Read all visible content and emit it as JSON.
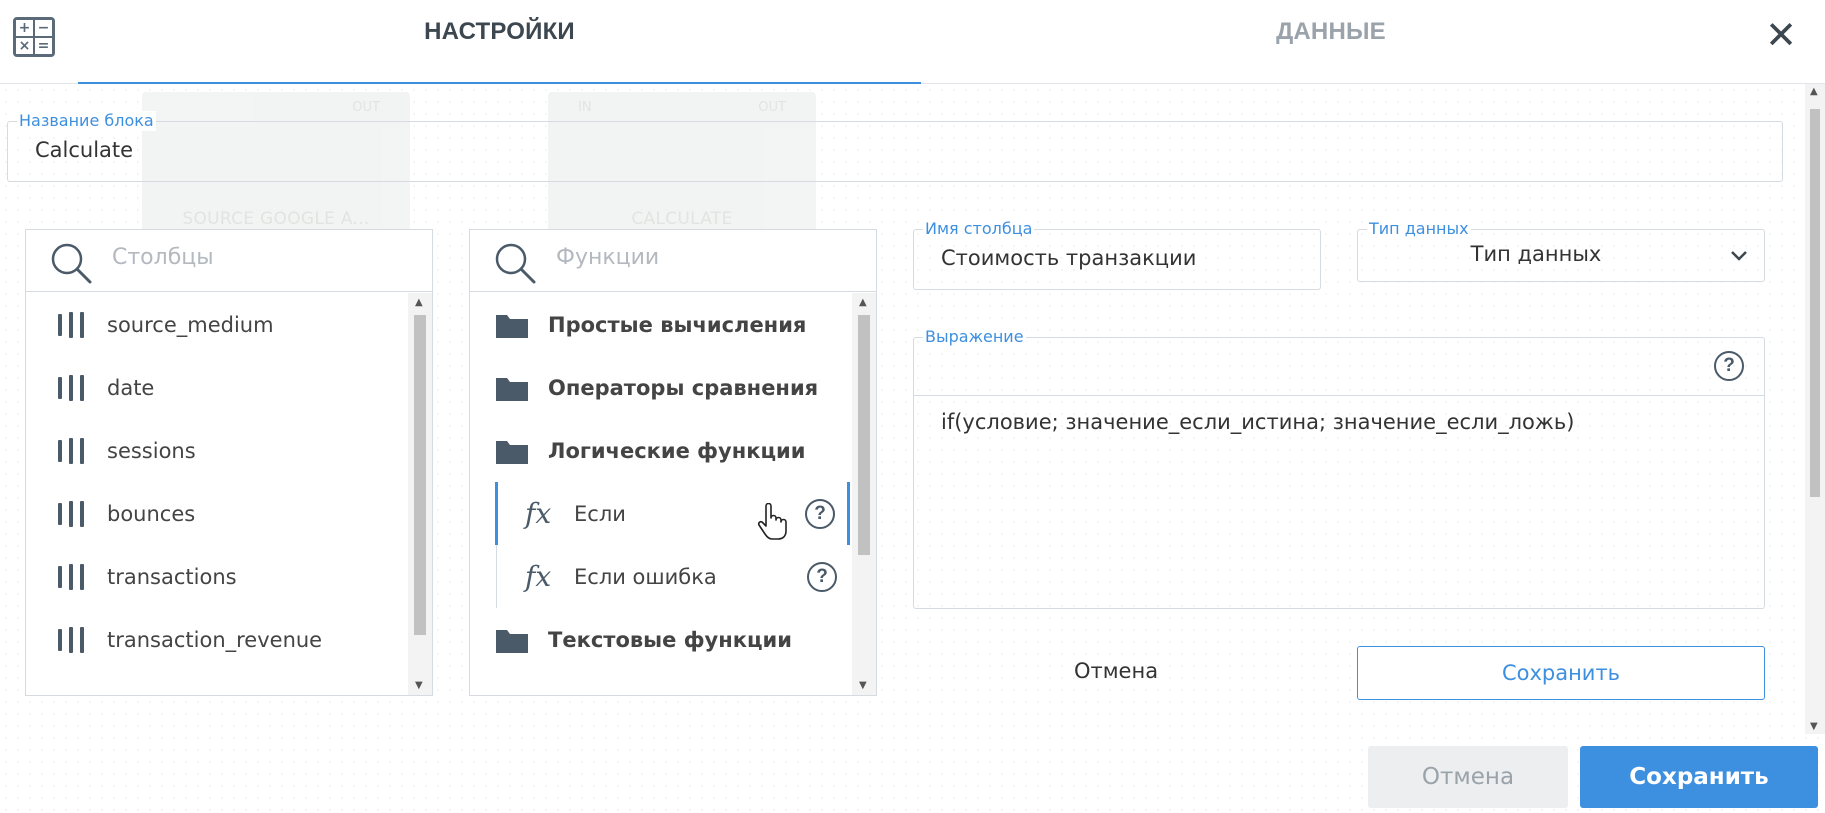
{
  "header": {
    "tabs": [
      {
        "label": "НАСТРОЙКИ",
        "active": true
      },
      {
        "label": "ДАННЫЕ",
        "active": false
      }
    ],
    "close_symbol": "✕"
  },
  "background_canvas": {
    "node_source": {
      "label": "SOURCE GOOGLE A...",
      "port_out": "OUT"
    },
    "node_calculate": {
      "label": "CALCULATE",
      "port_in": "IN",
      "port_out": "OUT"
    }
  },
  "block_name": {
    "legend": "Название блока",
    "value": "Calculate"
  },
  "columns_panel": {
    "placeholder": "Столбцы",
    "items": [
      {
        "label": "source_medium"
      },
      {
        "label": "date"
      },
      {
        "label": "sessions"
      },
      {
        "label": "bounces"
      },
      {
        "label": "transactions"
      },
      {
        "label": "transaction_revenue"
      }
    ]
  },
  "functions_panel": {
    "placeholder": "Функции",
    "folders": {
      "simple": "Простые вычисления",
      "comparison": "Операторы сравнения",
      "logical": "Логические функции",
      "text": "Текстовые функции"
    },
    "functions": {
      "if": "Если",
      "if_error": "Если ошибка"
    },
    "fx_symbol": "fx"
  },
  "column_name": {
    "legend": "Имя столбца",
    "value": "Стоимость транзакции"
  },
  "data_type": {
    "legend": "Тип данных",
    "value": "Тип данных"
  },
  "expression": {
    "legend": "Выражение",
    "value": "if(условие; значение_если_истина; значение_если_ложь)",
    "help_symbol": "?"
  },
  "inner_actions": {
    "cancel_label": "Отмена",
    "save_label": "Сохранить"
  },
  "footer": {
    "cancel_label": "Отмена",
    "save_label": "Сохранить"
  },
  "colors": {
    "accent": "#3d8fe0",
    "icon": "#4a5a68",
    "border": "#d5dbe0"
  }
}
